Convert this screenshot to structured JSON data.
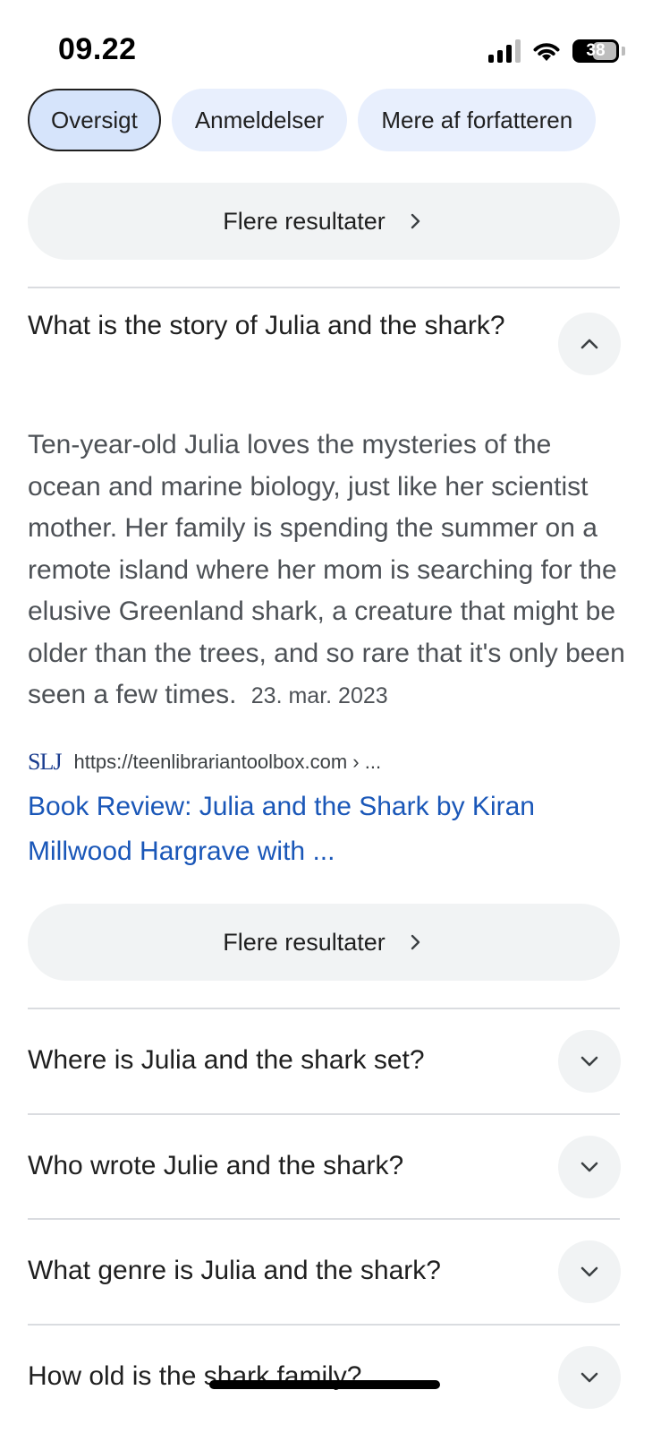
{
  "status_bar": {
    "time": "09.22",
    "battery": "38"
  },
  "tabs": [
    {
      "label": "Oversigt",
      "active": true
    },
    {
      "label": "Anmeldelser",
      "active": false
    },
    {
      "label": "Mere af forfatteren",
      "active": false
    }
  ],
  "more_results_label": "Flere resultater",
  "expanded_faq": {
    "question": "What is the story of Julia and the shark?",
    "answer": "Ten-year-old Julia loves the mysteries of the ocean and marine biology, just like her scientist mother. Her family is spending the summer on a remote island where her mom is searching for the elusive Greenland shark, a creature that might be older than the trees, and so rare that it's only been seen a few times.",
    "date": "23. mar. 2023",
    "source": {
      "logo": "SLJ",
      "url": "https://teenlibrariantoolbox.com › ...",
      "title": "Book Review: Julia and the Shark by Kiran Millwood Hargrave with ..."
    }
  },
  "collapsed_faqs": [
    {
      "question": "Where is Julia and the shark set?"
    },
    {
      "question": "Who wrote Julie and the shark?"
    },
    {
      "question": "What genre is Julia and the shark?"
    },
    {
      "question": "How old is the shark family?"
    }
  ],
  "icons": {
    "chevron_up": "chevron-up-icon",
    "chevron_down": "chevron-down-icon",
    "chevron_right": "chevron-right-icon"
  },
  "colors": {
    "link": "#1a57b8",
    "tab_bg": "#e8effd",
    "button_bg": "#f1f3f4"
  }
}
